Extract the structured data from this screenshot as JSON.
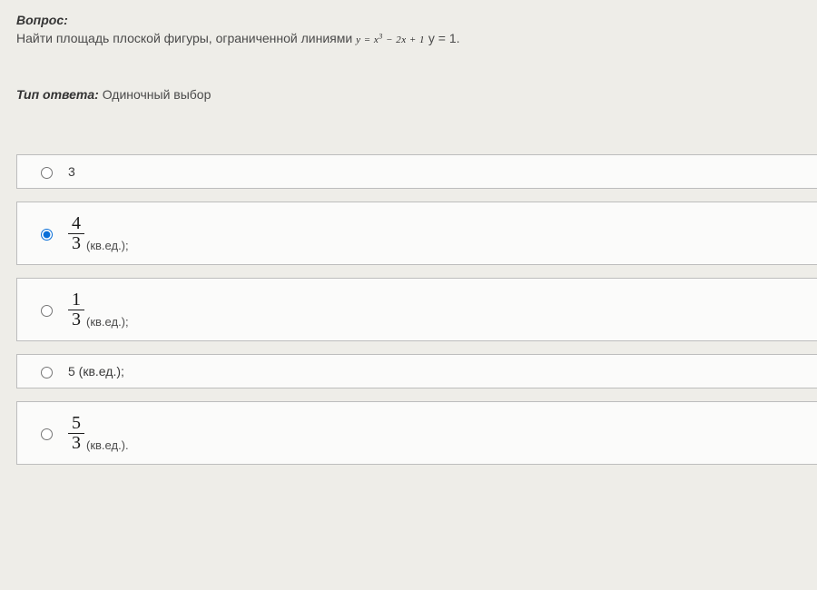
{
  "question": {
    "label": "Вопрос:",
    "text_before": "Найти площадь плоской фигуры, ограниченной линиями ",
    "formula_html": "y = x<sup>3</sup> − 2x + 1",
    "text_after": "  y = 1."
  },
  "answer_type": {
    "label": "Тип ответа:",
    "value": "Одиночный выбор"
  },
  "options": [
    {
      "type": "plain",
      "text": "3",
      "selected": false
    },
    {
      "type": "fraction",
      "num": "4",
      "den": "3",
      "unit": "(кв.ед.);",
      "selected": true
    },
    {
      "type": "fraction",
      "num": "1",
      "den": "3",
      "unit": "(кв.ед.);",
      "selected": false
    },
    {
      "type": "plain",
      "text": "5 (кв.ед.);",
      "selected": false
    },
    {
      "type": "fraction",
      "num": "5",
      "den": "3",
      "unit": "(кв.ед.).",
      "selected": false
    }
  ]
}
